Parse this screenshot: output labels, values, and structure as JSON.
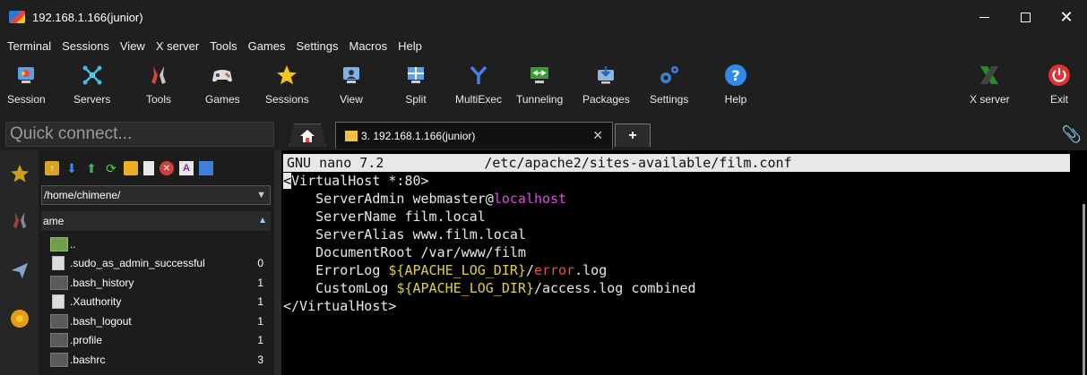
{
  "window": {
    "title": "192.168.1.166(junior)"
  },
  "menu": [
    "Terminal",
    "Sessions",
    "View",
    "X server",
    "Tools",
    "Games",
    "Settings",
    "Macros",
    "Help"
  ],
  "toolbar": {
    "buttons": [
      {
        "label": "Session",
        "icon": "session-icon"
      },
      {
        "label": "Servers",
        "icon": "servers-icon"
      },
      {
        "label": "Tools",
        "icon": "tools-icon"
      },
      {
        "label": "Games",
        "icon": "games-icon"
      },
      {
        "label": "Sessions",
        "icon": "star-icon"
      },
      {
        "label": "View",
        "icon": "view-icon"
      },
      {
        "label": "Split",
        "icon": "split-icon"
      },
      {
        "label": "MultiExec",
        "icon": "multiexec-icon"
      },
      {
        "label": "Tunneling",
        "icon": "tunneling-icon"
      },
      {
        "label": "Packages",
        "icon": "packages-icon"
      },
      {
        "label": "Settings",
        "icon": "settings-icon"
      },
      {
        "label": "Help",
        "icon": "help-icon"
      },
      {
        "label": "X server",
        "icon": "xserver-icon"
      },
      {
        "label": "Exit",
        "icon": "power-icon"
      }
    ]
  },
  "quick_connect": {
    "placeholder": "Quick connect..."
  },
  "tabs": {
    "session_tab": "3. 192.168.1.166(junior)"
  },
  "file_browser": {
    "path": "/home/chimene/",
    "column_name": "ame",
    "files": [
      {
        "name": "..",
        "size": ""
      },
      {
        "name": ".sudo_as_admin_successful",
        "size": "0"
      },
      {
        "name": ".bash_history",
        "size": "1"
      },
      {
        "name": ".Xauthority",
        "size": "1"
      },
      {
        "name": ".bash_logout",
        "size": "1"
      },
      {
        "name": ".profile",
        "size": "1"
      },
      {
        "name": ".bashrc",
        "size": "3"
      }
    ]
  },
  "terminal": {
    "nano_header_left": "GNU nano 7.2",
    "nano_header_file": "/etc/apache2/sites-available/film.conf",
    "line1_cursor": "<",
    "line1_rest": "VirtualHost *:80>",
    "line2_a": "    ServerAdmin webmaster@",
    "line2_b": "localhost",
    "line3": "    ServerName film.local",
    "line4": "    ServerAlias www.film.local",
    "line5": "    DocumentRoot /var/www/film",
    "line6_a": "    ErrorLog ",
    "line6_b": "${APACHE_LOG_DIR}",
    "line6_c": "/",
    "line6_d": "error",
    "line6_e": ".log",
    "line7_a": "    CustomLog ",
    "line7_b": "${APACHE_LOG_DIR}",
    "line7_c": "/access.log combined",
    "line8": "</VirtualHost>"
  }
}
